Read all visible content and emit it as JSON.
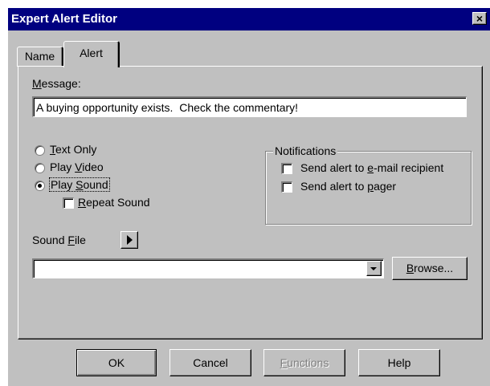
{
  "window": {
    "title": "Expert Alert Editor",
    "close_glyph": "×"
  },
  "tabs": [
    {
      "label": "Name",
      "selected": false
    },
    {
      "label": "Alert",
      "selected": true
    }
  ],
  "message": {
    "label_mnemonic": "M",
    "label_rest": "essage:",
    "value": "A buying opportunity exists.  Check the commentary!"
  },
  "playback_options": {
    "text_only": {
      "mnemonic": "T",
      "rest": "ext Only",
      "checked": false
    },
    "play_video": {
      "prefix": "Play ",
      "mnemonic": "V",
      "rest": "ideo",
      "checked": false
    },
    "play_sound": {
      "prefix": "Play ",
      "mnemonic": "S",
      "rest": "ound",
      "checked": true
    },
    "repeat_sound": {
      "mnemonic": "R",
      "rest": "epeat Sound",
      "checked": false
    }
  },
  "notifications": {
    "title": "Notifications",
    "email": {
      "prefix": "Send alert to ",
      "mnemonic": "e",
      "rest": "-mail recipient",
      "checked": false
    },
    "pager": {
      "prefix": "Send alert to ",
      "mnemonic": "p",
      "rest": "ager",
      "checked": false
    }
  },
  "sound_file": {
    "label_prefix": "Sound ",
    "label_mnemonic": "F",
    "label_rest": "ile",
    "value": "",
    "play_icon": "play-icon",
    "dropdown_icon": "chevron-down-icon",
    "browse_mnemonic": "B",
    "browse_rest": "rowse..."
  },
  "buttons": {
    "ok": "OK",
    "cancel": "Cancel",
    "functions_mnemonic": "F",
    "functions_rest": "unctions",
    "help": "Help"
  },
  "colors": {
    "titlebar": "#000080",
    "face": "#c0c0c0"
  }
}
